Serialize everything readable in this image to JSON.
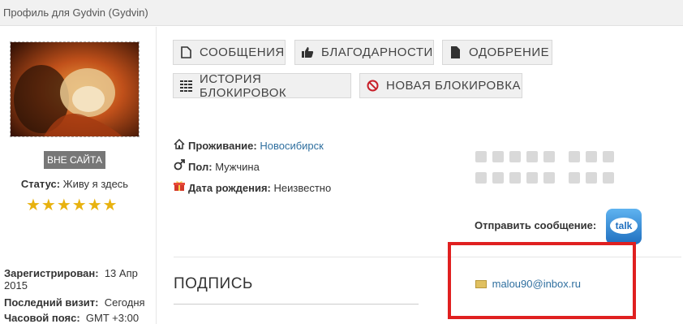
{
  "title": "Профиль для Gydvin (Gydvin)",
  "sidebar": {
    "status_badge": "ВНЕ САЙТА",
    "status_label": "Статус:",
    "status_value": "Живу я здесь",
    "stars": "★★★★★★",
    "stars_count": 6,
    "registered_label": "Зарегистрирован:",
    "registered_value": "13 Апр",
    "registered_year": "2015",
    "last_visit_label": "Последний визит:",
    "last_visit_value": "Сегодня",
    "timezone_label": "Часовой пояс:",
    "timezone_value": "GMT +3:00"
  },
  "buttons": {
    "messages": "СООБЩЕНИЯ",
    "thanks": "БЛАГОДАРНОСТИ",
    "approval": "ОДОБРЕНИЕ",
    "ban_history": "ИСТОРИЯ БЛОКИРОВОК",
    "new_ban": "НОВАЯ БЛОКИРОВКА"
  },
  "info": {
    "location_label": "Проживание:",
    "location_value": "Новосибирск",
    "gender_label": "Пол:",
    "gender_value": "Мужчина",
    "birthday_label": "Дата рождения:",
    "birthday_value": "Неизвестно"
  },
  "contact": {
    "send_label": "Отправить сообщение:",
    "talk_icon_text": "talk",
    "email": "malou90@inbox.ru"
  },
  "signature_heading": "ПОДПИСЬ",
  "colors": {
    "link": "#2f6f9f",
    "stars": "#e8b20f",
    "highlight": "#e02020",
    "badge": "#777777"
  }
}
